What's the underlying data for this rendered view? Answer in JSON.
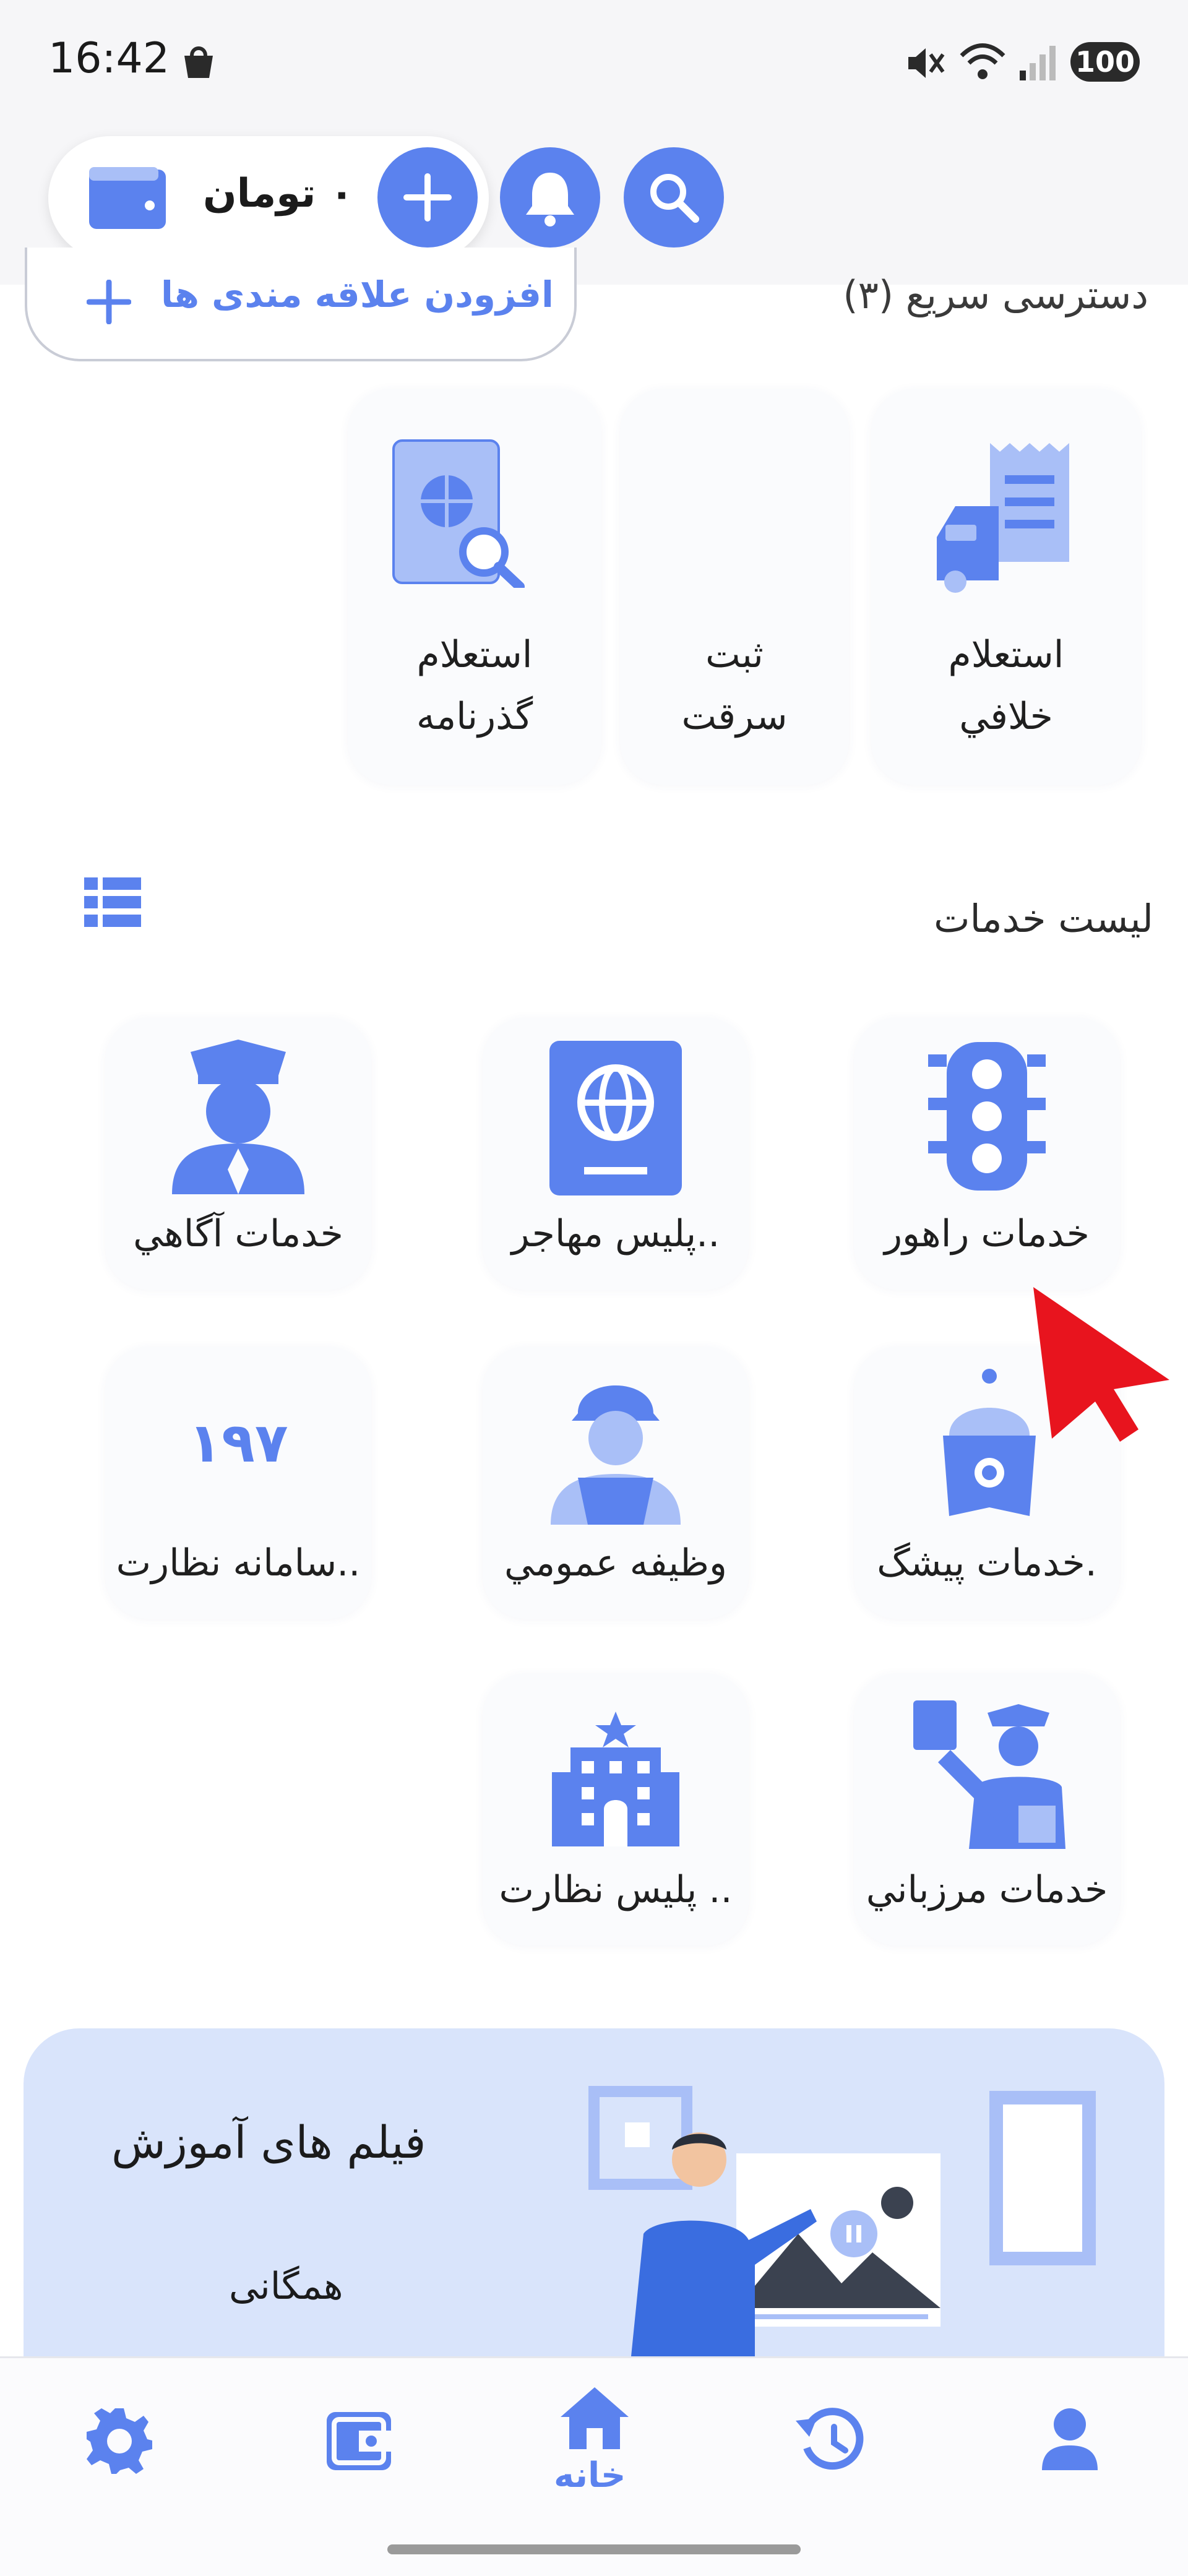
{
  "status_bar": {
    "time": "16:42",
    "battery": "100"
  },
  "header": {
    "balance": "۰ تومان"
  },
  "quick_access": {
    "title": "دسترسی سریع (۳)",
    "add_interest_label": "افزودن علاقه مندی ها",
    "items": [
      {
        "line1": "استعلام",
        "line2": "خلافي"
      },
      {
        "line1": "ثبت",
        "line2": "سرقت"
      },
      {
        "line1": "استعلام",
        "line2": "گذرنامه"
      }
    ]
  },
  "services": {
    "title": "لیست خدمات",
    "items": [
      {
        "label": "خدمات راهور"
      },
      {
        "label": "پلیس  مهاجر.."
      },
      {
        "label": "خدمات آگاهي"
      },
      {
        "label": "خدمات پیشگ."
      },
      {
        "label": "وظيفه عمومي"
      },
      {
        "label": "سامانه نظارت..",
        "badge": "۱۹۷"
      },
      {
        "label": "خدمات مرزباني"
      },
      {
        "label": "پلیس نظارت .."
      }
    ]
  },
  "banner": {
    "title": "فیلم های آموزش",
    "subtitle": "همگانی"
  },
  "bottom_nav": {
    "home_label": "خانه"
  },
  "colors": {
    "accent": "#5b82ee",
    "light_accent": "#a9bff7",
    "banner_bg": "#d9e4fb",
    "cursor": "#e8141e"
  },
  "icons": [
    "search-icon",
    "bell-icon",
    "plus-icon",
    "wallet-icon",
    "traffic-light-icon",
    "passport-icon",
    "police-officer-icon",
    "vip-service-icon",
    "soldier-icon",
    "building-icon",
    "border-control-icon",
    "list-view-icon",
    "settings-icon",
    "home-icon",
    "history-icon",
    "profile-icon"
  ]
}
